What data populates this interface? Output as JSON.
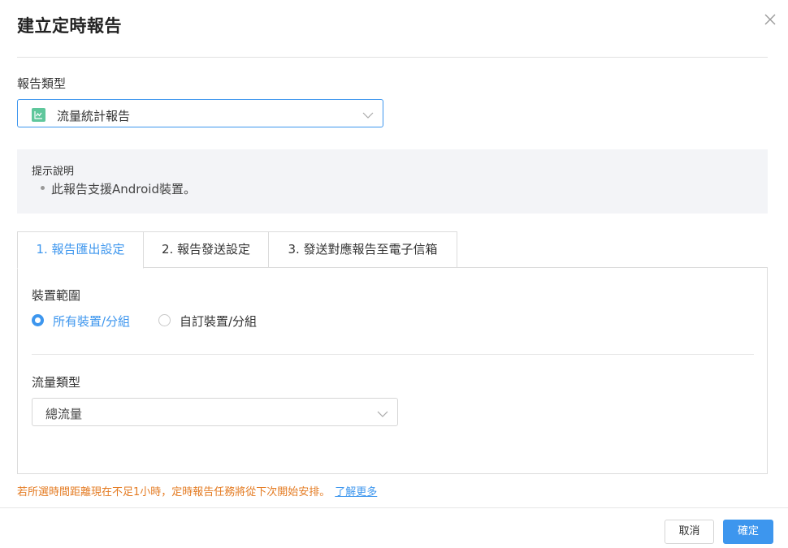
{
  "dialog": {
    "title": "建立定時報告"
  },
  "report_type": {
    "label": "報告類型",
    "selected": "流量統計報告",
    "icon": "chart-icon",
    "icon_color": "#5fc79c"
  },
  "hint": {
    "title": "提示說明",
    "items": [
      "此報告支援Android裝置。"
    ]
  },
  "tabs": [
    {
      "label": "1. 報告匯出設定",
      "active": true
    },
    {
      "label": "2. 報告發送設定",
      "active": false
    },
    {
      "label": "3. 發送對應報告至電子信箱",
      "active": false
    }
  ],
  "device_scope": {
    "label": "裝置範圍",
    "options": [
      {
        "label": "所有裝置/分組",
        "selected": true
      },
      {
        "label": "自訂裝置/分組",
        "selected": false
      }
    ]
  },
  "traffic_type": {
    "label": "流量類型",
    "selected": "總流量"
  },
  "note": {
    "text": "若所選時間距離現在不足1小時，定時報告任務將從下次開始安排。",
    "link": "了解更多"
  },
  "footer": {
    "cancel": "取消",
    "confirm": "確定"
  },
  "colors": {
    "accent": "#3d96ee",
    "warning": "#e47b22",
    "hint_bg": "#f3f4f7"
  }
}
